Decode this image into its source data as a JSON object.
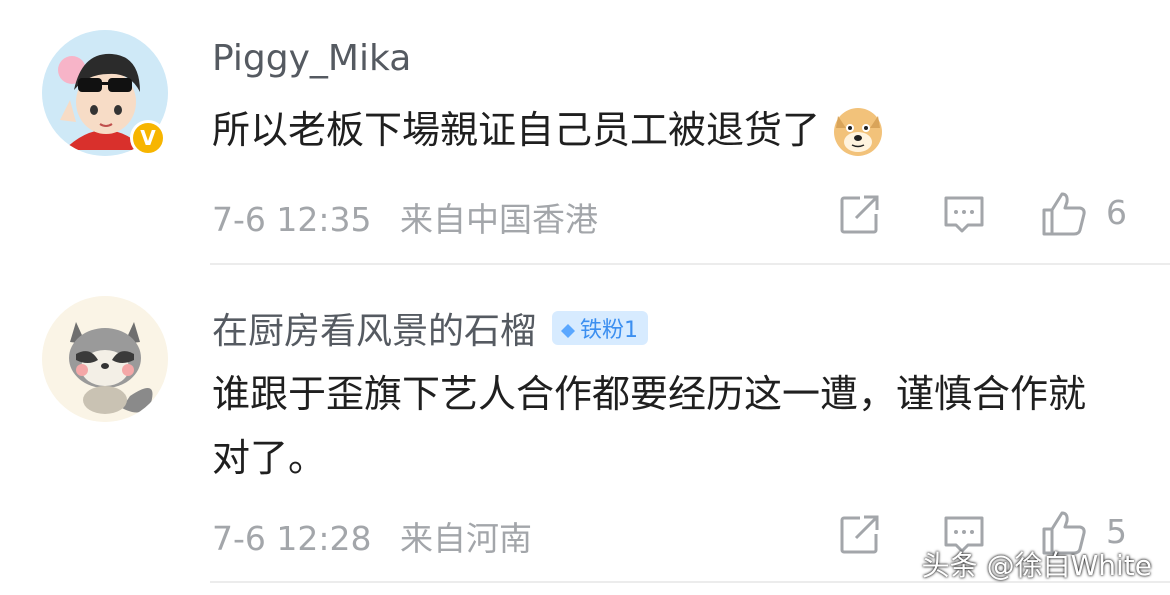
{
  "comments": [
    {
      "username": "Piggy_Mika",
      "text": "所以老板下場親证自己员工被退货了",
      "time": "7-6 12:35",
      "location": "来自中国香港",
      "likes": "6",
      "verified": true
    },
    {
      "username": "在厨房看风景的石榴",
      "badge": "铁粉1",
      "text": "谁跟于歪旗下艺人合作都要经历这一遭，谨慎合作就对了。",
      "time": "7-6 12:28",
      "location": "来自河南",
      "likes": "5"
    }
  ],
  "watermark": "头条 @徐白White",
  "icons": {
    "share": "share-icon",
    "reply": "comment-icon",
    "like": "thumbs-up-icon",
    "verified": "verified-v-icon",
    "emoji": "doge-emoji-icon"
  },
  "colors": {
    "verified": "#f7b500",
    "badge": "#3c8ff0",
    "meta": "#a3a6aa"
  }
}
